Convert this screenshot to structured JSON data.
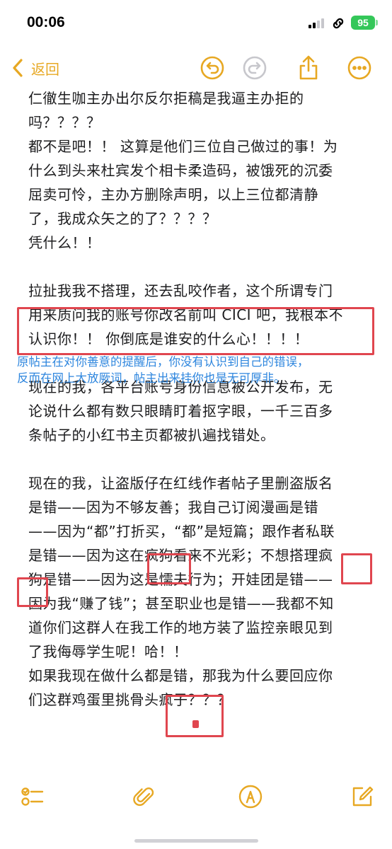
{
  "status_bar": {
    "time": "00:06",
    "battery": "95"
  },
  "nav": {
    "back_label": "返回"
  },
  "note": {
    "lines": [
      "仁徹生咖主办出尔反尔拒稿是我逼主办拒的",
      "吗？？？？",
      "都不是吧！！ 这算是他们三位自己做过的事！为",
      "什么到头来杜宾发个相卡柔造码，被饿死的沉委",
      "屈卖可怜，主办方删除声明，以上三位都清静",
      "了，我成众矢之的了？？？？",
      "凭什么！！",
      "",
      "拉扯我我不搭理，还去乱咬作者，这个所谓专门",
      "用来质问我的账号你改名前叫 CICI 吧，我根本不",
      "认识你！！ 你倒底是谁安的什么心！！！！",
      "",
      "现在的我，各平台账号身份信息被公开发布，无",
      "论说什么都有数只眼睛盯着抠字眼，一千三百多",
      "条帖子的小红书主页都被扒遍找错处。",
      "",
      "现在的我，让盗版仔在红线作者帖子里删盗版名",
      "是错——因为不够友善；我自己订阅漫画是错",
      "——因为“都”打折买，“都”是短篇；跟作者私联",
      "是错——因为这在疯狗看来不光彩；不想搭理疯",
      "狗是错——因为这是懦夫行为；开娃团是错——",
      "因为我“赚了钱”；甚至职业也是错——我都不知",
      "道你们这群人在我工作的地方装了监控亲眼见到",
      "了我侮辱学生呢！哈！！",
      "如果我现在做什么都是错，那我为什么要回应你",
      "们这群鸡蛋里挑骨头疯子？？？"
    ]
  },
  "overlay_caption": {
    "line1": "原帖主在对你善意的提醒后，你没有认识到自己的错误，",
    "line2": "反而在网上大放厥词，帖主出来挂你也是无可厚非。"
  },
  "colors": {
    "accent": "#e7a823",
    "annotation_red": "#e0464f",
    "caption_blue": "#2e86de",
    "battery_green": "#34c759"
  },
  "icons": {
    "nav": [
      "chevron-left-icon",
      "undo-icon",
      "redo-icon",
      "share-icon",
      "more-icon"
    ],
    "toolbar": [
      "checklist-icon",
      "paperclip-icon",
      "pen-markup-icon",
      "compose-icon"
    ]
  }
}
